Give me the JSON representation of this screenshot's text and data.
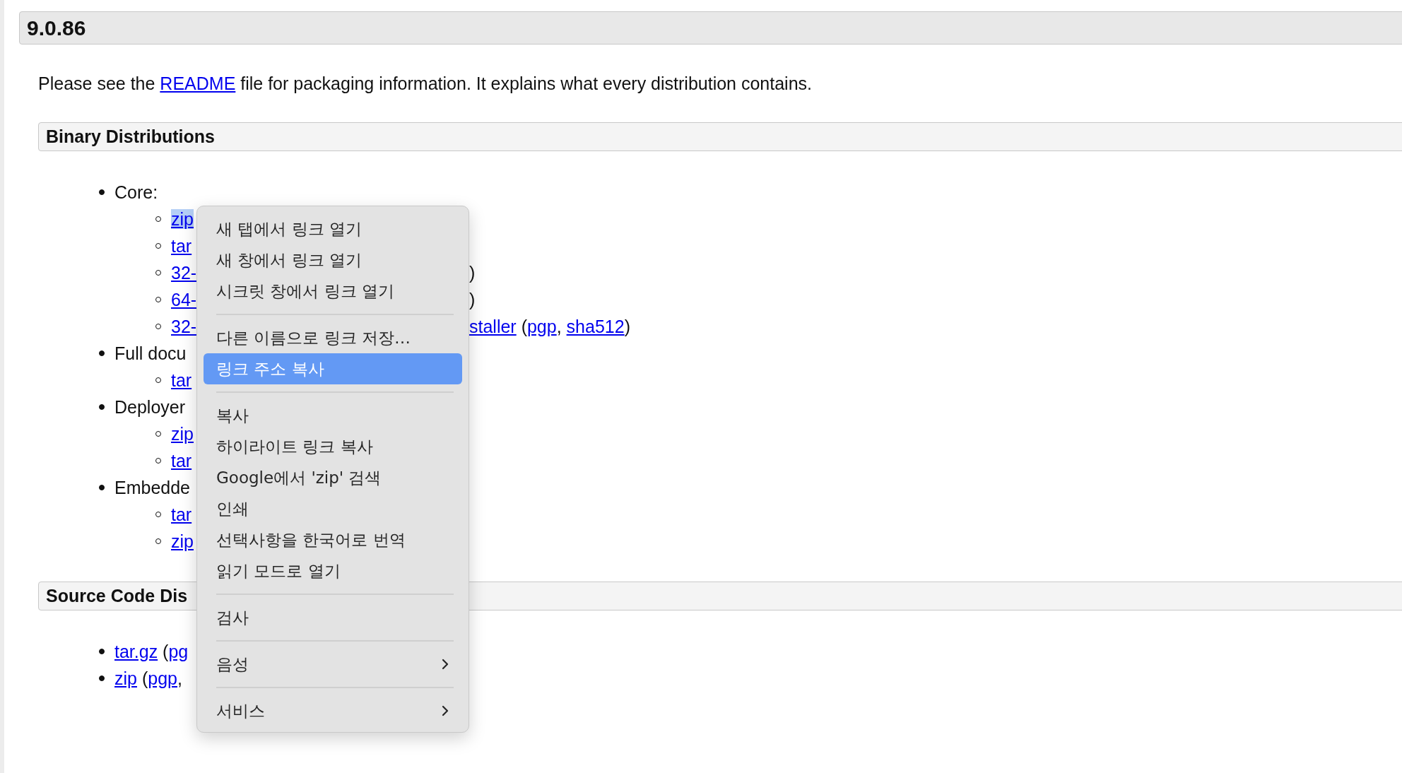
{
  "version_heading": "9.0.86",
  "intro": {
    "before": "Please see the ",
    "link": "README",
    "after": " file for packaging information. It explains what every distribution contains."
  },
  "sections": [
    {
      "heading": "Binary Distributions",
      "items": [
        {
          "left": [
            {
              "kind": "text",
              "text": "Core:"
            }
          ],
          "children": [
            {
              "left": [
                {
                  "kind": "link",
                  "text": "zip",
                  "highlighted": true
                }
              ]
            },
            {
              "left": [
                {
                  "kind": "link",
                  "text": "tar"
                }
              ]
            },
            {
              "left": [
                {
                  "kind": "link",
                  "text": "32-"
                }
              ],
              "right": [
                {
                  "kind": "text",
                  "text": ")"
                }
              ]
            },
            {
              "left": [
                {
                  "kind": "link",
                  "text": "64-"
                }
              ],
              "right": [
                {
                  "kind": "text",
                  "text": ")"
                }
              ]
            },
            {
              "left": [
                {
                  "kind": "link",
                  "text": "32-"
                }
              ],
              "right": [
                {
                  "kind": "link",
                  "text": "staller"
                },
                {
                  "kind": "text",
                  "text": " ("
                },
                {
                  "kind": "link",
                  "text": "pgp"
                },
                {
                  "kind": "text",
                  "text": ", "
                },
                {
                  "kind": "link",
                  "text": "sha512"
                },
                {
                  "kind": "text",
                  "text": ")"
                }
              ]
            }
          ]
        },
        {
          "left": [
            {
              "kind": "text",
              "text": "Full docu"
            }
          ],
          "children": [
            {
              "left": [
                {
                  "kind": "link",
                  "text": "tar"
                }
              ]
            }
          ]
        },
        {
          "left": [
            {
              "kind": "text",
              "text": "Deployer"
            }
          ],
          "children": [
            {
              "left": [
                {
                  "kind": "link",
                  "text": "zip"
                }
              ]
            },
            {
              "left": [
                {
                  "kind": "link",
                  "text": "tar"
                }
              ]
            }
          ]
        },
        {
          "left": [
            {
              "kind": "text",
              "text": "Embedde"
            }
          ],
          "children": [
            {
              "left": [
                {
                  "kind": "link",
                  "text": "tar"
                }
              ]
            },
            {
              "left": [
                {
                  "kind": "link",
                  "text": "zip"
                }
              ]
            }
          ]
        }
      ]
    },
    {
      "heading": "Source Code Dis",
      "items": [
        {
          "left": [
            {
              "kind": "link",
              "text": "tar.gz"
            },
            {
              "kind": "text",
              "text": " ("
            },
            {
              "kind": "link",
              "text": "pg"
            }
          ]
        },
        {
          "left": [
            {
              "kind": "link",
              "text": "zip"
            },
            {
              "kind": "text",
              "text": " ("
            },
            {
              "kind": "link",
              "text": "pgp"
            },
            {
              "kind": "text",
              "text": ","
            }
          ]
        }
      ]
    }
  ],
  "context_menu": {
    "groups": [
      [
        {
          "kind": "item",
          "label": "새 탭에서 링크 열기",
          "selected": false
        },
        {
          "kind": "item",
          "label": "새 창에서 링크 열기",
          "selected": false
        },
        {
          "kind": "item",
          "label": "시크릿 창에서 링크 열기",
          "selected": false
        }
      ],
      [
        {
          "kind": "item",
          "label": "다른 이름으로 링크 저장…",
          "selected": false
        },
        {
          "kind": "item",
          "label": "링크 주소 복사",
          "selected": true
        }
      ],
      [
        {
          "kind": "item",
          "label": "복사",
          "selected": false
        },
        {
          "kind": "item",
          "label": "하이라이트 링크 복사",
          "selected": false
        },
        {
          "kind": "item",
          "label": "Google에서 'zip' 검색",
          "selected": false
        },
        {
          "kind": "item",
          "label": "인쇄",
          "selected": false
        },
        {
          "kind": "item",
          "label": "선택사항을 한국어로 번역",
          "selected": false
        },
        {
          "kind": "item",
          "label": "읽기 모드로 열기",
          "selected": false
        }
      ],
      [
        {
          "kind": "item",
          "label": "검사",
          "selected": false
        }
      ],
      [
        {
          "kind": "submenu",
          "label": "음성",
          "selected": false
        }
      ],
      [
        {
          "kind": "submenu",
          "label": "서비스",
          "selected": false
        }
      ]
    ]
  }
}
